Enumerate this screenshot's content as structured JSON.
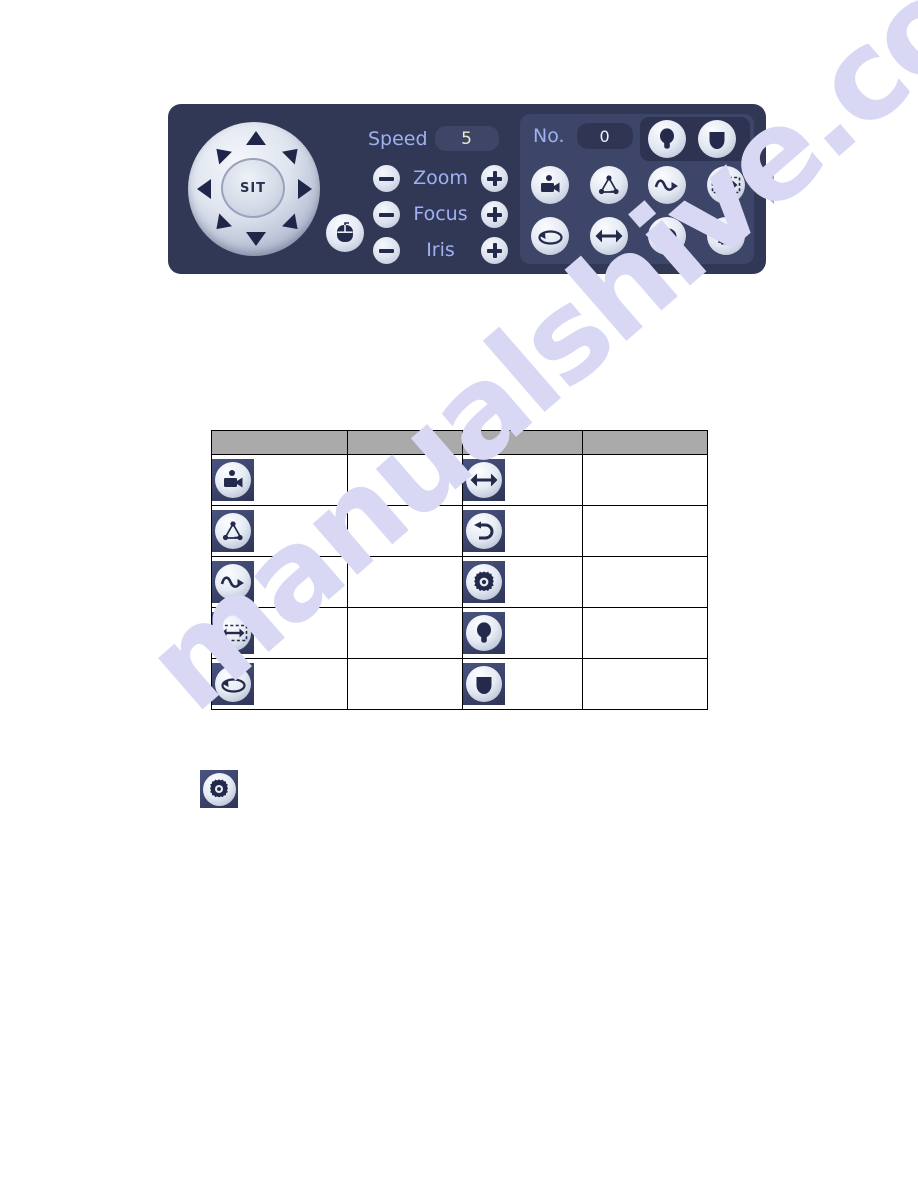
{
  "page": {
    "background_color": "#ffffff",
    "watermark_text": "manualshive.com",
    "watermark_color": "#d8d8f4"
  },
  "ptz_panel": {
    "background_color": "#313856",
    "accent_label_color": "#9fb0f0",
    "direction_pad": {
      "center_button_label": "SIT",
      "arrows": [
        "up-arrow",
        "up-right-arrow",
        "right-arrow",
        "down-right-arrow",
        "down-arrow",
        "down-left-arrow",
        "left-arrow",
        "up-left-arrow"
      ]
    },
    "mouse_button": {
      "icon": "mouse-icon"
    },
    "speed": {
      "label": "Speed",
      "value": "5"
    },
    "adjustments": [
      {
        "label": "Zoom",
        "minus": "−",
        "plus": "+"
      },
      {
        "label": "Focus",
        "minus": "−",
        "plus": "+"
      },
      {
        "label": "Iris",
        "minus": "−",
        "plus": "+"
      }
    ],
    "preset": {
      "label": "No.",
      "value": "0"
    },
    "light_group": [
      {
        "icon": "light-bulb-icon"
      },
      {
        "icon": "wiper-icon"
      }
    ],
    "function_grid_row_1": [
      {
        "icon": "camera-icon"
      },
      {
        "icon": "tour-nodes-icon"
      },
      {
        "icon": "pattern-wave-icon"
      },
      {
        "icon": "auto-scan-icon"
      }
    ],
    "function_grid_row_2": [
      {
        "icon": "auto-pan-rotate-icon"
      },
      {
        "icon": "flip-horizontal-icon"
      },
      {
        "icon": "reset-return-icon"
      },
      {
        "icon": "gear-settings-icon"
      }
    ],
    "collapse_handle": {
      "icon": "left-triangle-icon"
    }
  },
  "table": {
    "header_background_color": "#aaaaaa",
    "headers": [
      "",
      "",
      "",
      ""
    ],
    "rows": [
      {
        "icon_1": "camera-icon",
        "desc_1": "",
        "icon_2": "flip-horizontal-icon",
        "desc_2": ""
      },
      {
        "icon_1": "tour-nodes-icon",
        "desc_1": "",
        "icon_2": "reset-return-icon",
        "desc_2": ""
      },
      {
        "icon_1": "pattern-wave-icon",
        "desc_1": "",
        "icon_2": "gear-settings-icon",
        "desc_2": ""
      },
      {
        "icon_1": "auto-scan-icon",
        "desc_1": "",
        "icon_2": "light-bulb-icon",
        "desc_2": ""
      },
      {
        "icon_1": "auto-pan-rotate-icon",
        "desc_1": "",
        "icon_2": "wiper-icon",
        "desc_2": ""
      }
    ]
  },
  "standalone": {
    "icon": "gear-settings-icon"
  }
}
